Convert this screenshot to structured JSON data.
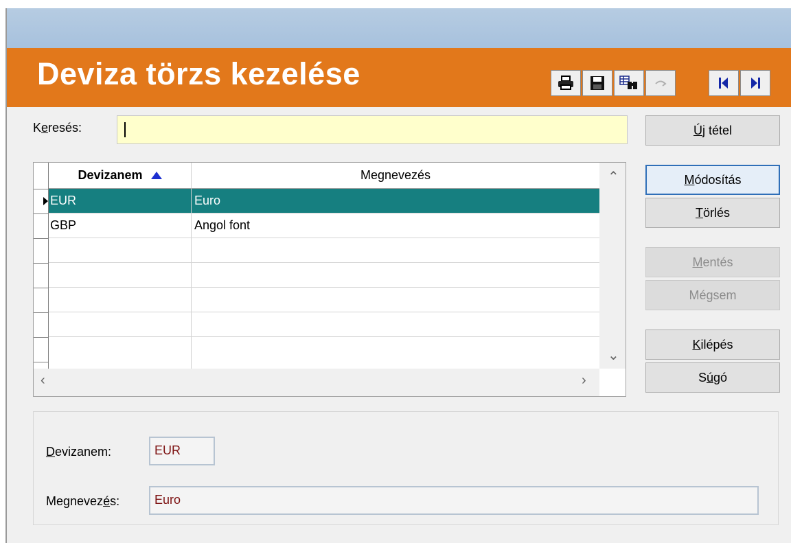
{
  "header": {
    "title": "Deviza törzs kezelése"
  },
  "toolbar": [
    {
      "name": "print-icon",
      "enabled": true
    },
    {
      "name": "save-icon",
      "enabled": true
    },
    {
      "name": "search-binoculars-icon",
      "enabled": true
    },
    {
      "name": "undo-icon",
      "enabled": false
    },
    {
      "name": "first-record-icon",
      "enabled": true
    },
    {
      "name": "last-record-icon",
      "enabled": true
    }
  ],
  "search": {
    "label_prefix": "K",
    "label_underlined": "e",
    "label_suffix": "resés:",
    "value": ""
  },
  "buttons": {
    "new": {
      "u": "Ú",
      "rest": "j tétel"
    },
    "modify": {
      "u": "M",
      "rest": "ódosítás"
    },
    "delete": {
      "u": "T",
      "rest": "örlés"
    },
    "save": {
      "u": "M",
      "rest": "entés"
    },
    "cancel": {
      "pre": "Mé",
      "u": "g",
      "rest": "sem"
    },
    "exit": {
      "u": "K",
      "rest": "ilépés"
    },
    "help": {
      "pre": "S",
      "u": "ú",
      "rest": "gó"
    }
  },
  "grid": {
    "columns": [
      "Devizanem",
      "Megnevezés"
    ],
    "sort_column": "Devizanem",
    "sort_direction": "ascending",
    "rows": [
      {
        "code": "EUR",
        "name": "Euro",
        "selected": true
      },
      {
        "code": "GBP",
        "name": "Angol font",
        "selected": false
      }
    ]
  },
  "details": {
    "currency_label": {
      "u": "D",
      "rest": "evizanem:"
    },
    "currency_value": "EUR",
    "name_label": {
      "pre": "Megnevez",
      "u": "é",
      "rest": "s:"
    },
    "name_value": "Euro"
  },
  "colors": {
    "header_bg": "#e2781b",
    "title_bar": "#a7c1dd",
    "selected_row": "#167f80",
    "search_bg": "#ffffcc",
    "field_text": "#7d1212",
    "sort_arrow": "#1c2fd0"
  }
}
